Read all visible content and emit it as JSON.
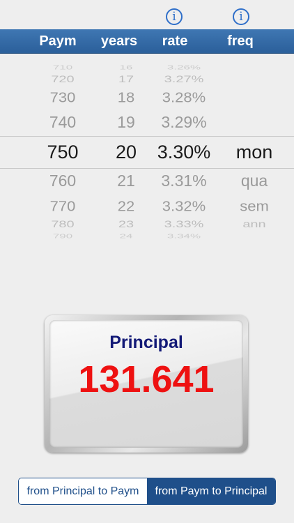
{
  "info_icons": [
    {
      "glyph": "i",
      "icon": "info-icon"
    },
    {
      "glyph": "i",
      "icon": "info-icon"
    }
  ],
  "header": {
    "columns": [
      "Paym",
      "years",
      "rate",
      "freq"
    ]
  },
  "picker": {
    "rows": [
      {
        "paym": "710",
        "years": "16",
        "rate": "3.26%",
        "freq": ""
      },
      {
        "paym": "720",
        "years": "17",
        "rate": "3.27%",
        "freq": ""
      },
      {
        "paym": "730",
        "years": "18",
        "rate": "3.28%",
        "freq": ""
      },
      {
        "paym": "740",
        "years": "19",
        "rate": "3.29%",
        "freq": ""
      },
      {
        "paym": "750",
        "years": "20",
        "rate": "3.30%",
        "freq": "mon"
      },
      {
        "paym": "760",
        "years": "21",
        "rate": "3.31%",
        "freq": "qua"
      },
      {
        "paym": "770",
        "years": "22",
        "rate": "3.32%",
        "freq": "sem"
      },
      {
        "paym": "780",
        "years": "23",
        "rate": "3.33%",
        "freq": "ann"
      },
      {
        "paym": "790",
        "years": "24",
        "rate": "3.34%",
        "freq": ""
      }
    ],
    "selected_index": 4
  },
  "result": {
    "label": "Principal",
    "value": "131.641"
  },
  "segmented": {
    "left_label": "from Principal to Paym",
    "right_label": "from Paym to Principal",
    "selected": "right"
  },
  "colors": {
    "header_blue": "#2f6aa6",
    "info_blue": "#2f6fc9",
    "value_red": "#ee1111",
    "label_navy": "#131a77",
    "segment_blue": "#1f4f8a"
  }
}
